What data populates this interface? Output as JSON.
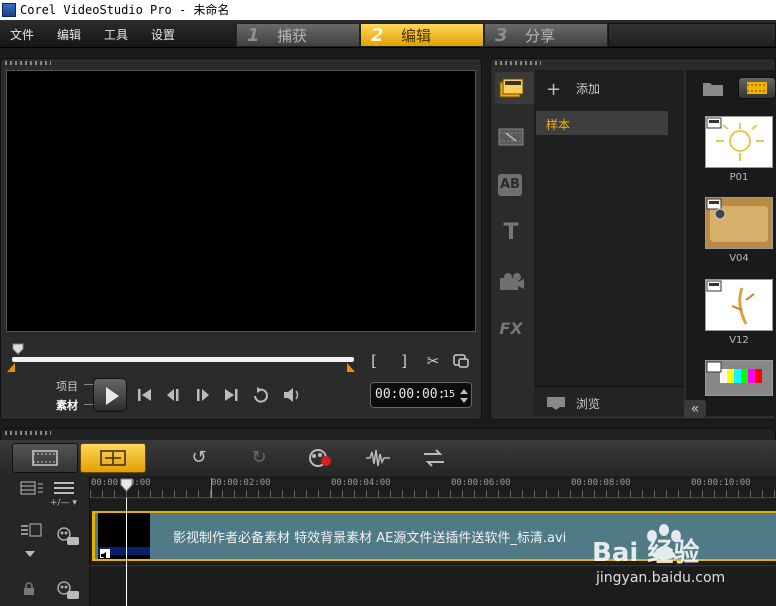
{
  "window": {
    "title": "Corel VideoStudio Pro - 未命名"
  },
  "menu": {
    "items": [
      "文件",
      "编辑",
      "工具",
      "设置"
    ]
  },
  "steps": [
    {
      "num": "1",
      "label": "捕获"
    },
    {
      "num": "2",
      "label": "编辑"
    },
    {
      "num": "3",
      "label": "分享"
    }
  ],
  "player": {
    "mode_project": "项目",
    "mode_clip": "素材",
    "timecode": "00:00:00:",
    "timecode_frames": "15",
    "mark_in": "[",
    "mark_out": "]"
  },
  "library": {
    "add_label": "添加",
    "folder_item": "样本",
    "browse_label": "浏览",
    "side_icons": [
      "media-icon",
      "transition-icon",
      "title-icon",
      "graphic-icon",
      "filter-icon"
    ],
    "side_text": {
      "ab": "AB",
      "t": "T",
      "fx": "FX"
    },
    "thumbs": [
      "P01",
      "V04",
      "V12"
    ]
  },
  "timeline": {
    "ruler": [
      "00:00:00:00",
      "00:00:02:00",
      "00:00:04:00",
      "00:00:06:00",
      "00:00:08:00",
      "00:00:10:00"
    ],
    "zoom_control": "+/— ▾",
    "clip_title": "影视制作者必备素材 特效背景素材 AE源文件送插件送软件_标清.avi"
  },
  "watermark": {
    "brand": "Bai 经验",
    "url": "jingyan.baidu.com"
  }
}
